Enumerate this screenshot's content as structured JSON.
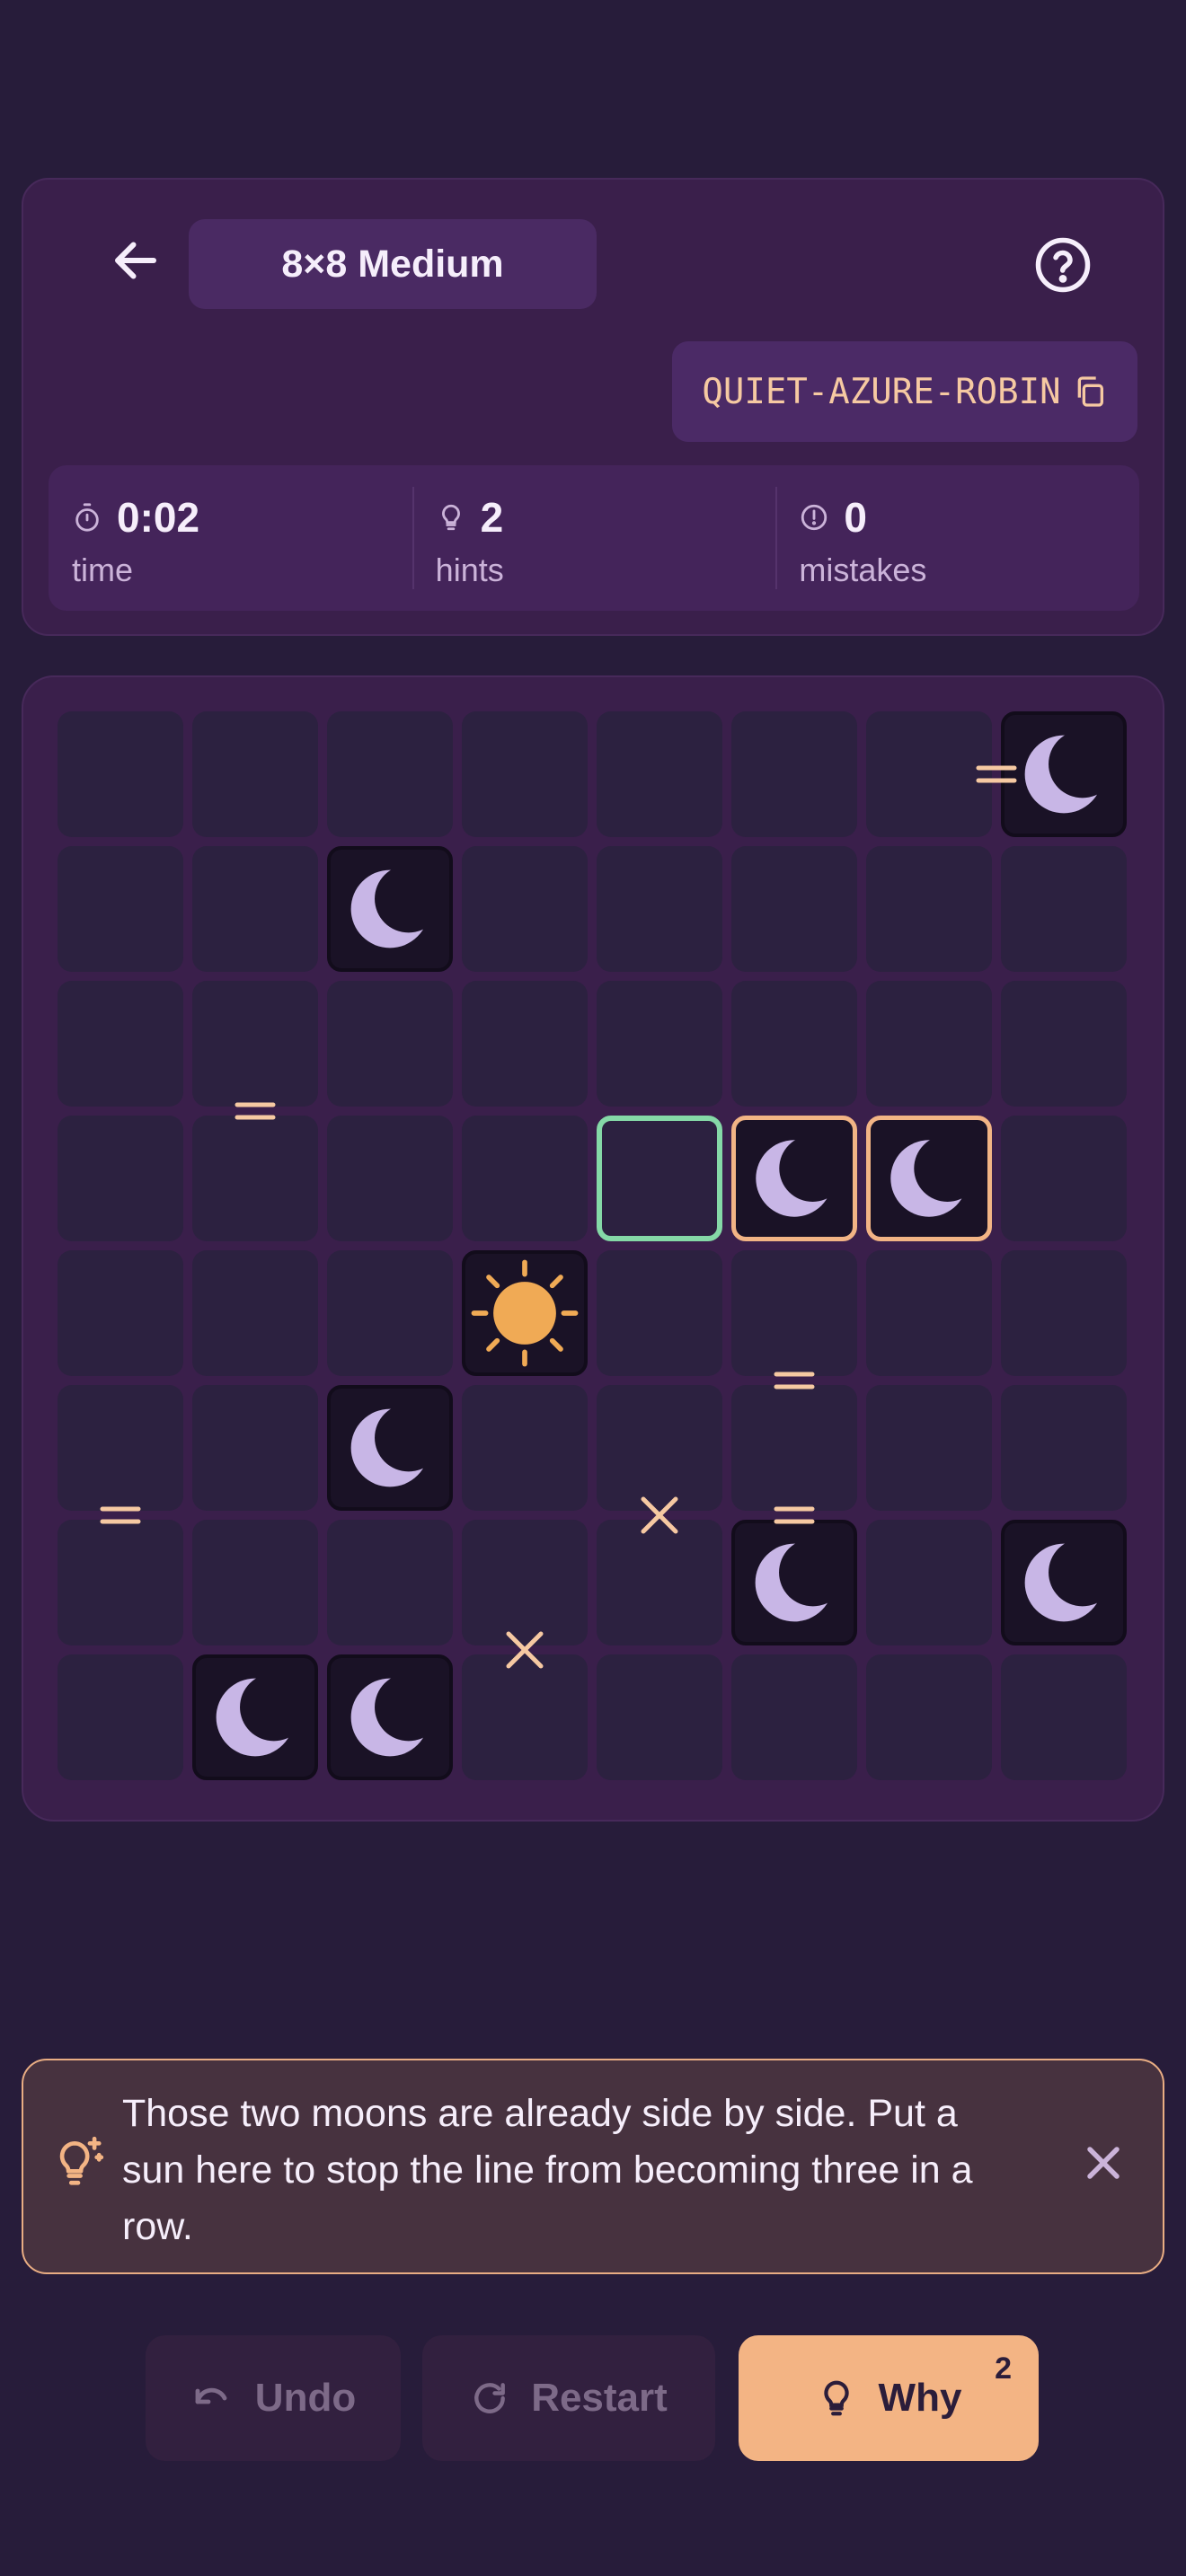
{
  "header": {
    "title": "8×8 Medium",
    "seed": "QUIET-AZURE-ROBIN"
  },
  "stats": {
    "time": {
      "value": "0:02",
      "label": "time"
    },
    "hints": {
      "value": "2",
      "label": "hints"
    },
    "mistakes": {
      "value": "0",
      "label": "mistakes"
    }
  },
  "board": {
    "rows": 8,
    "cols": 8,
    "cells": [
      [
        "",
        "",
        "",
        "",
        "",
        "",
        "",
        "moon"
      ],
      [
        "",
        "",
        "moon",
        "",
        "",
        "",
        "",
        ""
      ],
      [
        "",
        "",
        "",
        "",
        "",
        "",
        "",
        ""
      ],
      [
        "",
        "",
        "",
        "",
        "",
        "moon",
        "moon",
        ""
      ],
      [
        "",
        "",
        "",
        "sun",
        "",
        "",
        "",
        ""
      ],
      [
        "",
        "",
        "moon",
        "",
        "",
        "",
        "",
        ""
      ],
      [
        "",
        "",
        "",
        "",
        "",
        "moon",
        "",
        "moon"
      ],
      [
        "",
        "moon",
        "moon",
        "",
        "",
        "",
        "",
        ""
      ]
    ],
    "hint_cell": [
      3,
      4
    ],
    "highlight_cells": [
      [
        3,
        5
      ],
      [
        3,
        6
      ]
    ],
    "constraints": [
      {
        "type": "=",
        "between": [
          [
            0,
            6
          ],
          [
            0,
            7
          ]
        ]
      },
      {
        "type": "=",
        "between": [
          [
            2,
            1
          ],
          [
            3,
            1
          ]
        ]
      },
      {
        "type": "=",
        "between": [
          [
            4,
            5
          ],
          [
            5,
            5
          ]
        ]
      },
      {
        "type": "=",
        "between": [
          [
            5,
            5
          ],
          [
            6,
            5
          ]
        ]
      },
      {
        "type": "=",
        "between": [
          [
            5,
            0
          ],
          [
            6,
            0
          ]
        ]
      },
      {
        "type": "×",
        "between": [
          [
            5,
            4
          ],
          [
            6,
            4
          ]
        ]
      },
      {
        "type": "×",
        "between": [
          [
            6,
            3
          ],
          [
            7,
            3
          ]
        ]
      }
    ],
    "colors": {
      "moon": "#c8b6e6",
      "sun": "#f0aa55",
      "constraint": "#f6c9a2",
      "hint_border": "#85d8a7",
      "highlight_border": "#f2b485"
    }
  },
  "hint": {
    "message": "Those two moons are already side by side. Put a sun here to stop the line from becoming three in a row."
  },
  "actions": {
    "undo_label": "Undo",
    "restart_label": "Restart",
    "why_label": "Why",
    "why_badge": "2"
  },
  "icons": {
    "back": "arrow-left-icon",
    "help": "question-circle-icon",
    "copy": "copy-icon",
    "timer": "stopwatch-icon",
    "hints": "lightbulb-icon",
    "mistakes": "alert-circle-icon",
    "hint_banner": "sparkle-lightbulb-icon",
    "close": "close-icon",
    "undo": "undo-arrow-icon",
    "restart": "refresh-icon",
    "why": "lightbulb-icon"
  }
}
